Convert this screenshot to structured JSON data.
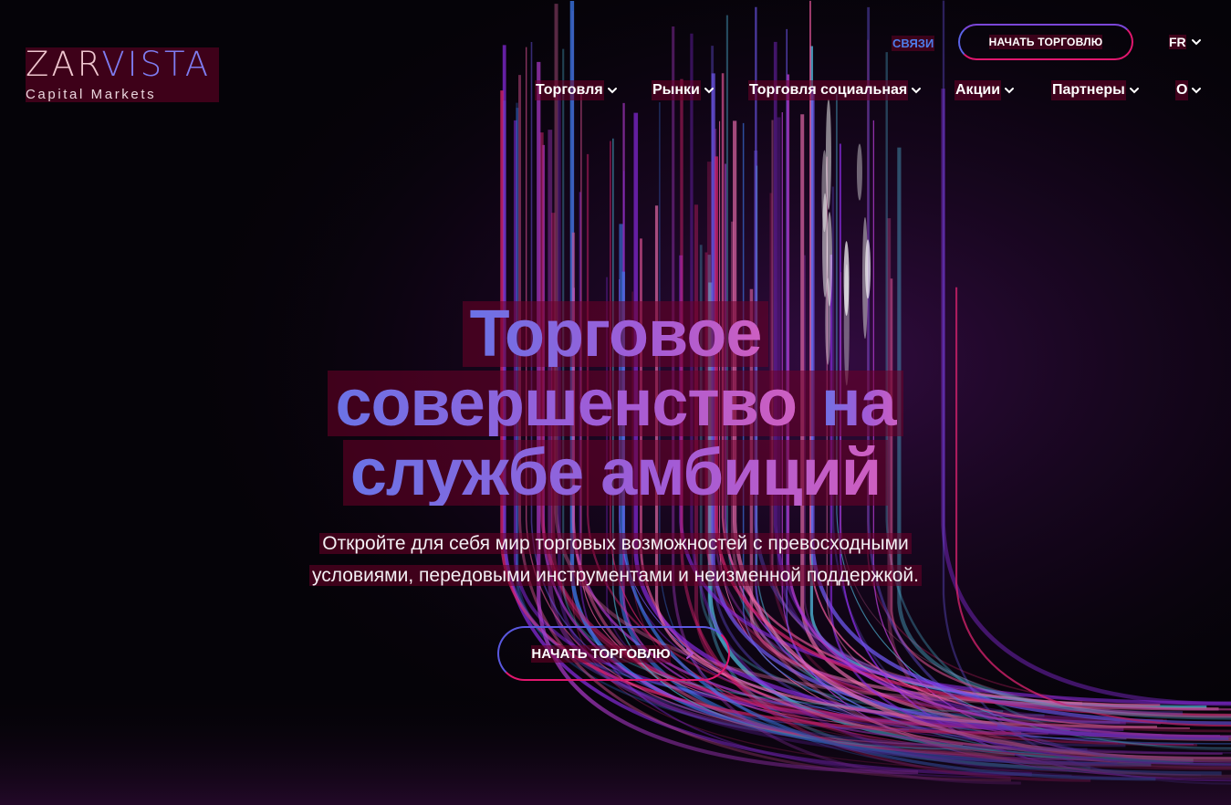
{
  "brand": {
    "logo_part1": "ZAR",
    "logo_part2": "VISTA",
    "tagline": "Capital Markets"
  },
  "header": {
    "contact_label": "СВЯЗИ",
    "cta_label": "НАЧАТЬ ТОРГОВЛЮ",
    "language": "FR"
  },
  "nav": {
    "items": [
      {
        "label": "Торговля"
      },
      {
        "label": "Рынки"
      },
      {
        "label": "Торговля социальная"
      },
      {
        "label": "Акции"
      },
      {
        "label": "Партнеры"
      },
      {
        "label": "О"
      }
    ]
  },
  "hero": {
    "title_line1": "Торговое",
    "title_line2a": "совершенство",
    "title_line2b": "на",
    "title_line3": "службе амбиций",
    "subtitle_line1": "Откройте для себя мир торговых возможностей с превосходными",
    "subtitle_line2": "условиями, передовыми инструментами и неизменной поддержкой.",
    "cta_label": "НАЧАТЬ ТОРГОВЛЮ"
  },
  "colors": {
    "accent_blue": "#5a6ae6",
    "accent_pink": "#e0176e",
    "background": "#050308"
  },
  "icons": {
    "chevron": "chevron-down-icon",
    "arrow": "chevron-right-icon"
  }
}
